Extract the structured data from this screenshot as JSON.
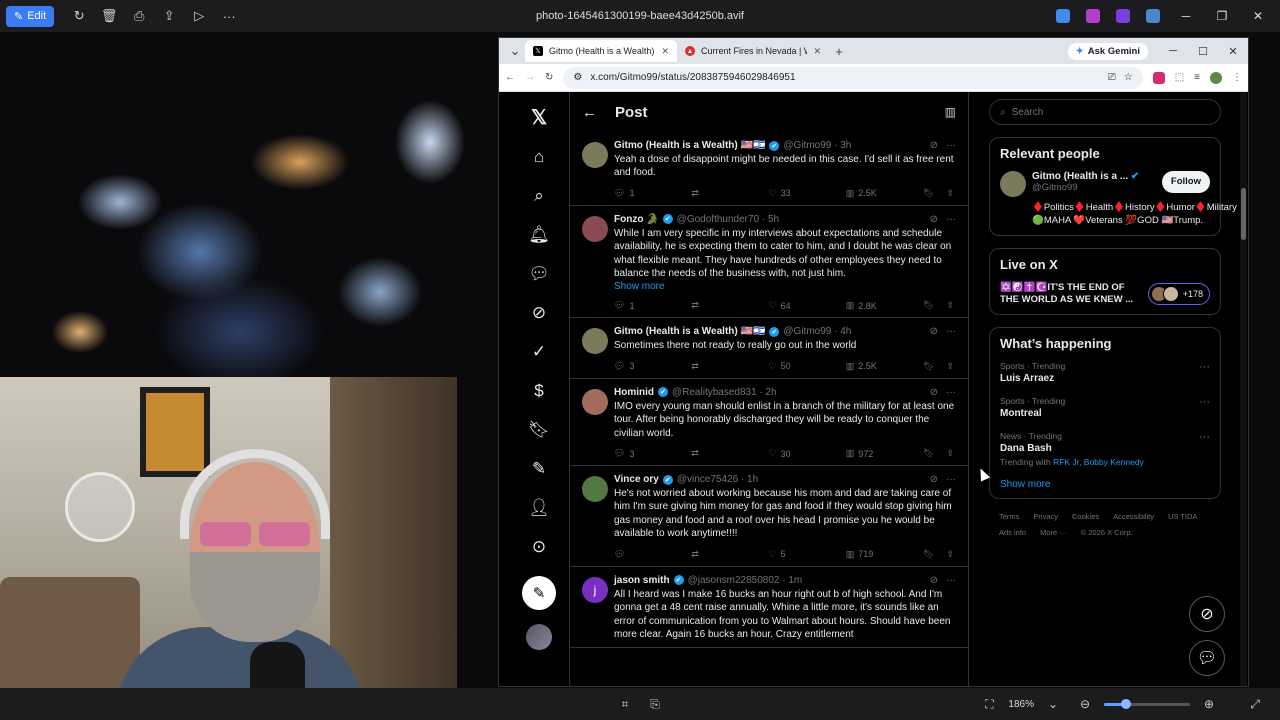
{
  "viewer": {
    "edit_label": "Edit",
    "file_title": "photo-1645461300199-baee43d4250b.avif",
    "zoom_level": "186%",
    "zoom_fraction": 0.26
  },
  "browser": {
    "tabs": [
      {
        "label": "Gitmo (Health is a Wealth) usu",
        "icon_color": "#000000",
        "active": true
      },
      {
        "label": "Current Fires in Nevada | WFCA",
        "icon_color": "#d62d2d",
        "active": false
      }
    ],
    "gemini_label": "Ask Gemini",
    "url": "x.com/Gitmo99/status/2083875946029846951"
  },
  "xpage": {
    "header_title": "Post",
    "tweets": [
      {
        "name": "Gitmo (Health is a Wealth) 🇺🇸🇮🇱",
        "handle": "@Gitmo99 · 3h",
        "text": "Yeah a dose of disappoint might be needed in this case. I'd sell it as free rent and food.",
        "show_more": "",
        "replies": "1",
        "reposts": "",
        "likes": "33",
        "views": "2.5K",
        "avatar_color": "#7b7a5a"
      },
      {
        "name": "Fonzo 🐊",
        "handle": "@Godofthunder70 · 5h",
        "text": "While I am very specific in my interviews about expectations and schedule availability, he is expecting them to cater to him, and I doubt he was clear on what flexible meant. They have hundreds of other employees they need to balance the needs of the business with, not just him.",
        "show_more": "Show more",
        "replies": "1",
        "reposts": "",
        "likes": "64",
        "views": "2.8K",
        "avatar_color": "#8a4a52"
      },
      {
        "name": "Gitmo (Health is a Wealth) 🇺🇸🇮🇱",
        "handle": "@Gitmo99 · 4h",
        "text": "Sometimes there not ready to really go out in the world",
        "show_more": "",
        "replies": "3",
        "reposts": "",
        "likes": "50",
        "views": "2.5K",
        "avatar_color": "#7b7a5a"
      },
      {
        "name": "Hominid",
        "handle": "@Realitybased831 · 2h",
        "text": "IMO every young man should enlist in a branch of the military for at least one tour. After being honorably discharged they will be ready to conquer the civilian world.",
        "show_more": "",
        "replies": "3",
        "reposts": "",
        "likes": "30",
        "views": "972",
        "avatar_color": "#a26b5e"
      },
      {
        "name": "Vince ory",
        "handle": "@vince75426 · 1h",
        "text": "He's not worried about working because his mom and dad are taking care of him I'm sure giving him money for gas and food if they would stop giving him gas money and food and a roof over his head I promise you he would be available to work anytime!!!!",
        "show_more": "",
        "replies": "",
        "reposts": "",
        "likes": "5",
        "views": "719",
        "avatar_color": "#557744"
      },
      {
        "name": "jason smith",
        "handle": "@jasonsm22850802 · 1m",
        "text": "All I heard was I make 16 bucks an hour right out b of high school. And I'm gonna get a 48 cent raise annually. Whine a little more, it's sounds like an error of communication from you to Walmart about hours. Should have been more clear. Again 16 bucks an hour. Crazy entitlement",
        "show_more": "",
        "replies": "",
        "reposts": "",
        "likes": "",
        "views": "",
        "avatar_color": "#7a2fc2",
        "avatar_letter": "j"
      }
    ]
  },
  "sidebar": {
    "search_placeholder": "Search",
    "relevant_title": "Relevant people",
    "person": {
      "name": "Gitmo (Health is a ...",
      "handle": "@Gitmo99",
      "follow_label": "Follow",
      "bio": "♦️Politics♦️Health♦️History♦️Humor♦️Military🟢MAHA ❤️Veterans 💯GOD 🇺🇸Trump."
    },
    "live_title": "Live on X",
    "live_text": "✡️☯️✝️☪️IT'S THE END OF THE WORLD AS WE KNEW ...",
    "live_count": "+178",
    "happening_title": "What’s happening",
    "trends": [
      {
        "category": "Sports · Trending",
        "title": "Luis Arraez",
        "with_label": "",
        "with_links": ""
      },
      {
        "category": "Sports · Trending",
        "title": "Montreal",
        "with_label": "",
        "with_links": ""
      },
      {
        "category": "News · Trending",
        "title": "Dana Bash",
        "with_label": "Trending with",
        "with_links": "RFK Jr, Bobby Kennedy"
      }
    ],
    "show_more": "Show more",
    "footer_links": [
      "Terms",
      "Privacy",
      "Cookies",
      "Accessibility",
      "US TIDA",
      "Ads info",
      "More ···",
      "© 2026 X Corp."
    ]
  }
}
